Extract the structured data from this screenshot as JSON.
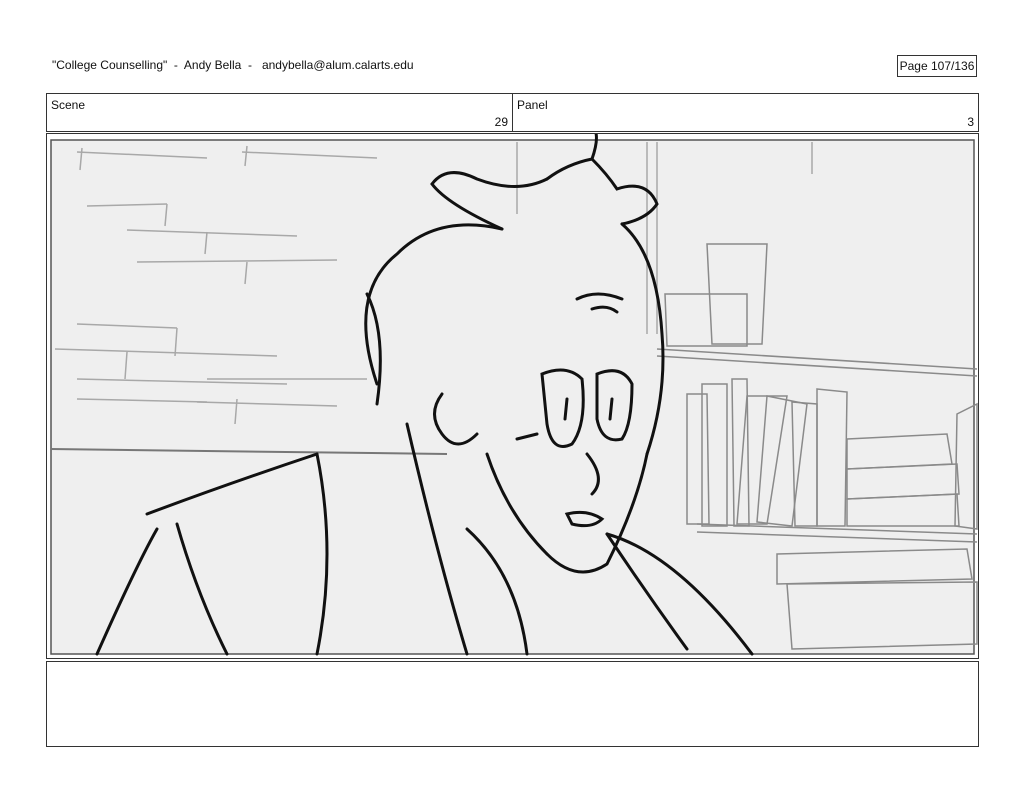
{
  "header": {
    "title": "\"College Counselling\"  -  Andy Bella  -   andybella@alum.calarts.edu",
    "page": "Page 107/136"
  },
  "scene": {
    "label": "Scene",
    "number": "29"
  },
  "panel": {
    "label": "Panel",
    "number": "3"
  },
  "notes": {
    "text": ""
  }
}
